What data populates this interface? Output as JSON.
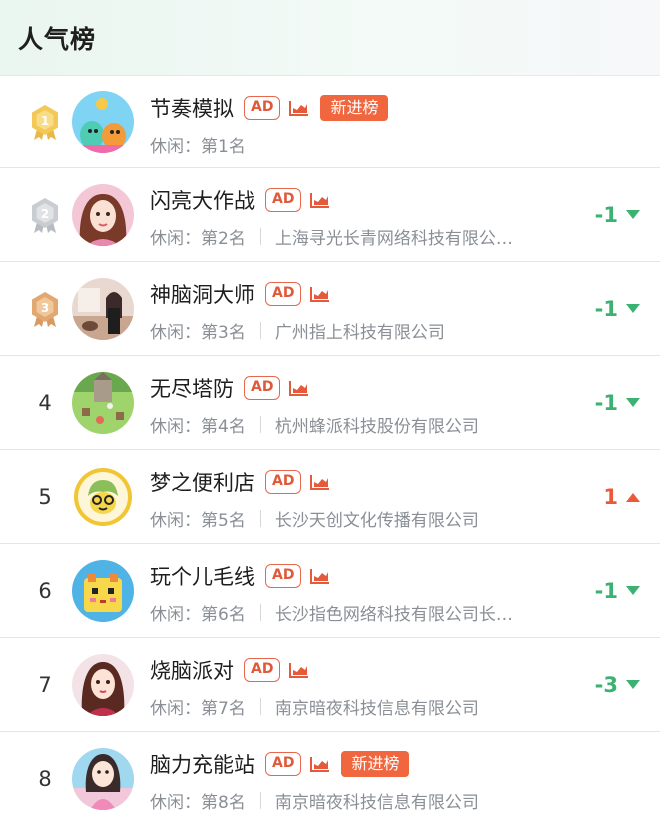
{
  "header": {
    "title": "人气榜"
  },
  "labels": {
    "ad": "AD",
    "new": "新进榜"
  },
  "colors": {
    "accent_orange": "#f0663f",
    "up": "#ea5a3a",
    "down": "#3cb272"
  },
  "items": [
    {
      "rank": "1",
      "name": "节奏模拟",
      "category": "休闲：",
      "rank_text": "第1名",
      "company": "",
      "change": "",
      "direction": "none",
      "is_new": true,
      "medal": "gold-medal"
    },
    {
      "rank": "2",
      "name": "闪亮大作战",
      "category": "休闲：",
      "rank_text": "第2名",
      "company": "上海寻光长青网络科技有限公…",
      "change": "-1",
      "direction": "down",
      "is_new": false,
      "medal": "silver-medal"
    },
    {
      "rank": "3",
      "name": "神脑洞大师",
      "category": "休闲：",
      "rank_text": "第3名",
      "company": "广州指上科技有限公司",
      "change": "-1",
      "direction": "down",
      "is_new": false,
      "medal": "bronze-medal"
    },
    {
      "rank": "4",
      "name": "无尽塔防",
      "category": "休闲：",
      "rank_text": "第4名",
      "company": "杭州蜂派科技股份有限公司",
      "change": "-1",
      "direction": "down",
      "is_new": false
    },
    {
      "rank": "5",
      "name": "梦之便利店",
      "category": "休闲：",
      "rank_text": "第5名",
      "company": "长沙天创文化传播有限公司",
      "change": "1",
      "direction": "up",
      "is_new": false
    },
    {
      "rank": "6",
      "name": "玩个儿毛线",
      "category": "休闲：",
      "rank_text": "第6名",
      "company": "长沙指色网络科技有限公司长…",
      "change": "-1",
      "direction": "down",
      "is_new": false
    },
    {
      "rank": "7",
      "name": "烧脑派对",
      "category": "休闲：",
      "rank_text": "第7名",
      "company": "南京暗夜科技信息有限公司",
      "change": "-3",
      "direction": "down",
      "is_new": false
    },
    {
      "rank": "8",
      "name": "脑力充能站",
      "category": "休闲：",
      "rank_text": "第8名",
      "company": "南京暗夜科技信息有限公司",
      "change": "",
      "direction": "none",
      "is_new": true
    }
  ]
}
